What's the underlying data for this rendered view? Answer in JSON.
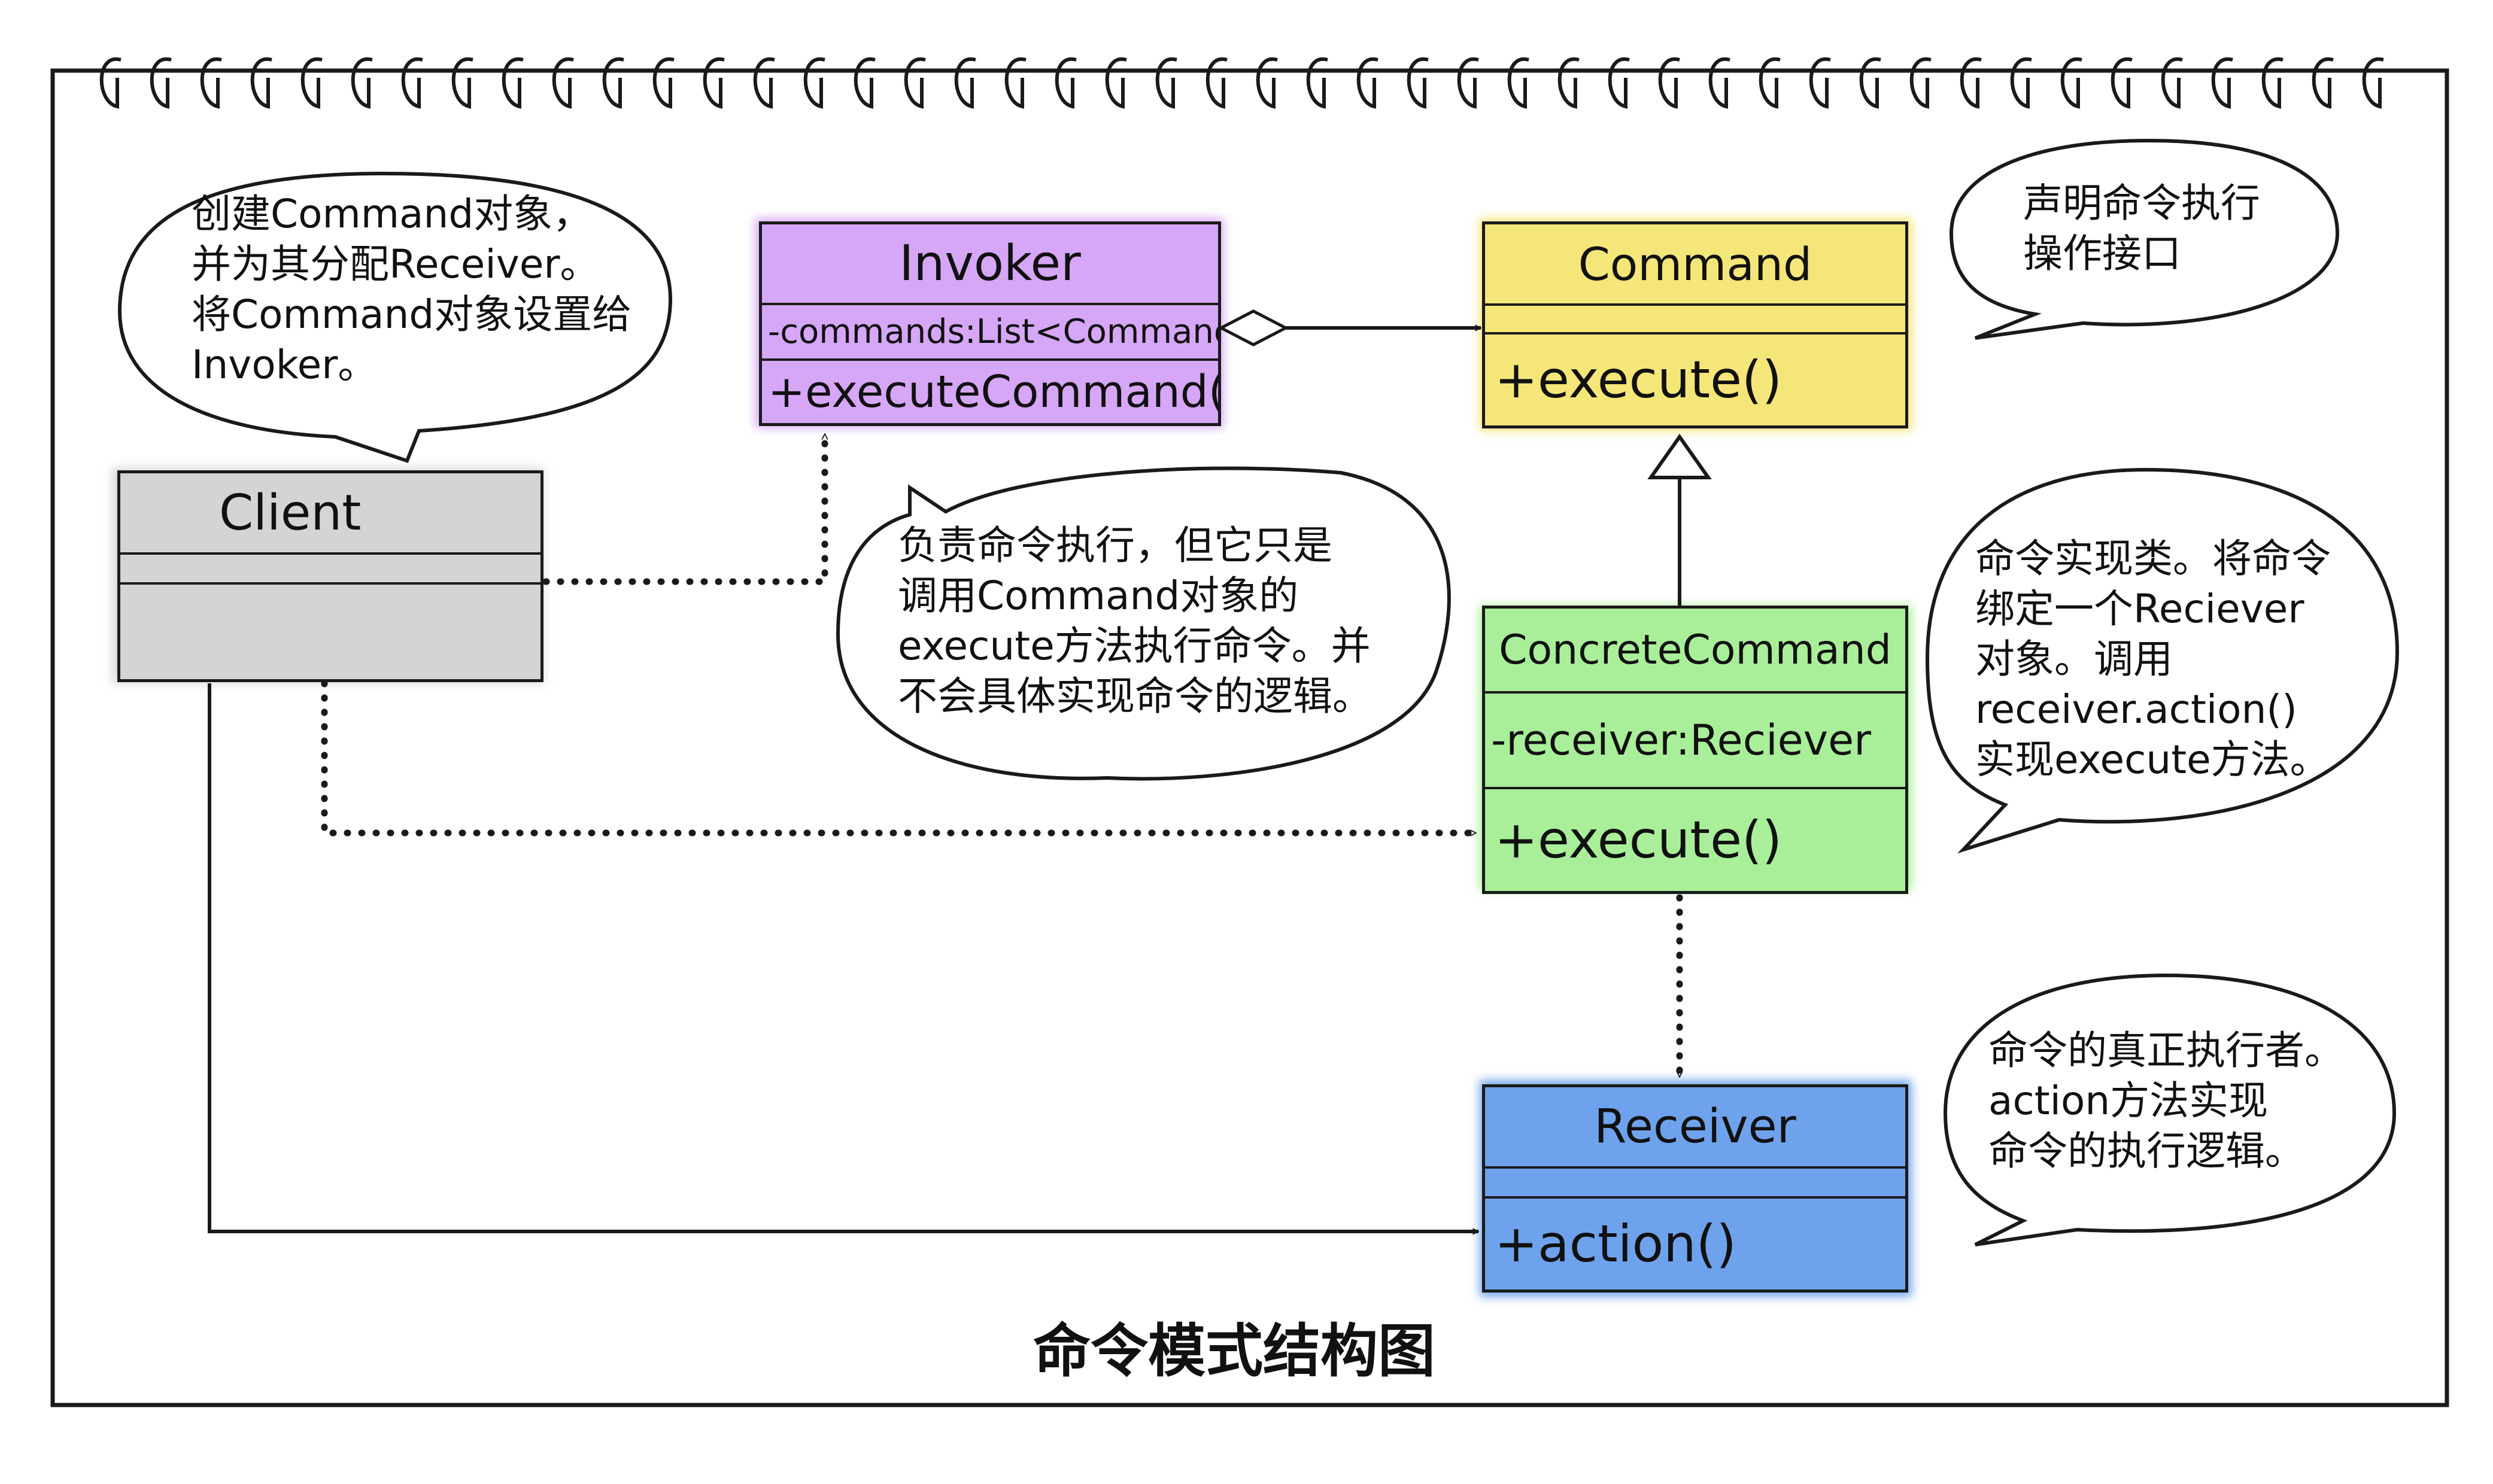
{
  "title": "命令模式结构图",
  "classes": {
    "client": {
      "name": "Client",
      "attributes": "",
      "methods": "",
      "color": "#d4d4d4"
    },
    "invoker": {
      "name": "Invoker",
      "attributes": "-commands:List<Command>",
      "methods": "+executeCommand()",
      "color": "#d6a6f7"
    },
    "command": {
      "name": "Command",
      "attributes": "",
      "methods": "+execute()",
      "color": "#f4e678"
    },
    "concrete_command": {
      "name": "ConcreteCommand",
      "attributes": "-receiver:Reciever",
      "methods": "+execute()",
      "color": "#a9ef99"
    },
    "receiver": {
      "name": "Receiver",
      "attributes": "",
      "methods": "+action()",
      "color": "#6ea2ec"
    }
  },
  "notes": {
    "client_note": "创建Command对象，\n并为其分配Receiver。\n将Command对象设置给\nInvoker。",
    "invoker_note": "负责命令执行，但它只是\n调用Command对象的\nexecute方法执行命令。并\n不会具体实现命令的逻辑。",
    "command_note": "声明命令执行\n操作接口",
    "concrete_note": "命令实现类。将命令\n绑定一个Reciever\n对象。调用\nreceiver.action()\n实现execute方法。",
    "receiver_note": "命令的真正执行者。\naction方法实现\n命令的执行逻辑。"
  },
  "relations": [
    {
      "from": "Invoker",
      "to": "Command",
      "type": "aggregation"
    },
    {
      "from": "ConcreteCommand",
      "to": "Command",
      "type": "realization"
    },
    {
      "from": "Client",
      "to": "Invoker",
      "type": "dependency"
    },
    {
      "from": "Client",
      "to": "ConcreteCommand",
      "type": "dependency"
    },
    {
      "from": "ConcreteCommand",
      "to": "Receiver",
      "type": "dependency"
    },
    {
      "from": "Client",
      "to": "Receiver",
      "type": "association"
    }
  ]
}
